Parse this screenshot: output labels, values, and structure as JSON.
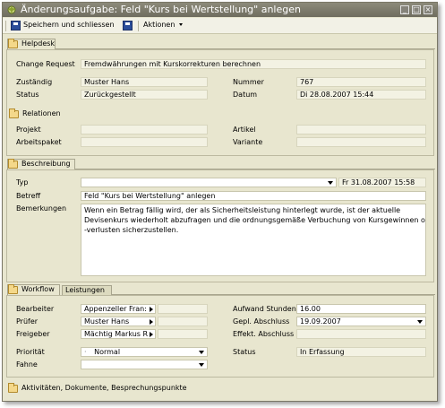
{
  "window": {
    "title": "Änderungsaufgabe: Feld \"Kurs bei Wertstellung\" anlegen"
  },
  "toolbar": {
    "save_close_label": "Speichern und schliessen",
    "actions_label": "Aktionen"
  },
  "helpdesk": {
    "header": "Helpdesk",
    "change_request_label": "Change Request",
    "change_request_value": "Fremdwährungen mit Kurskorrekturen berechnen",
    "zustaendig_label": "Zuständig",
    "zustaendig_value": "Muster Hans",
    "nummer_label": "Nummer",
    "nummer_value": "767",
    "status_label": "Status",
    "status_value": "Zurückgestellt",
    "datum_label": "Datum",
    "datum_value": "Di 28.08.2007 15:44"
  },
  "relationen": {
    "header": "Relationen",
    "projekt_label": "Projekt",
    "projekt_value": "",
    "artikel_label": "Artikel",
    "artikel_value": "",
    "arbeitspaket_label": "Arbeitspaket",
    "arbeitspaket_value": "",
    "variante_label": "Variante",
    "variante_value": ""
  },
  "beschreibung": {
    "header": "Beschreibung",
    "typ_label": "Typ",
    "typ_value": "",
    "typ_date": "Fr 31.08.2007 15:58",
    "betreff_label": "Betreff",
    "betreff_value": "Feld \"Kurs bei Wertstellung\" anlegen",
    "bemerkungen_label": "Bemerkungen",
    "bemerkungen_line1": "Wenn ein Betrag fällig wird, der als Sicherheitsleistung hinterlegt wurde, ist der aktuelle",
    "bemerkungen_line2": "Devisenkurs wiederholt abzufragen und die ordnungsgemäße Verbuchung von Kursgewinnen oder",
    "bemerkungen_line3": "-verlusten sicherzustellen."
  },
  "workflow": {
    "tab_workflow": "Workflow",
    "tab_leistungen": "Leistungen",
    "bearbeiter_label": "Bearbeiter",
    "bearbeiter_value": "Appenzeller Fran:",
    "pruefer_label": "Prüfer",
    "pruefer_value": "Muster Hans",
    "freigeber_label": "Freigeber",
    "freigeber_value": "Mächtig Markus R",
    "aufwand_label": "Aufwand Stunden",
    "aufwand_value": "16.00",
    "gepl_label": "Gepl. Abschluss",
    "gepl_value": "19.09.2007",
    "effekt_label": "Effekt. Abschluss",
    "effekt_value": "",
    "prioritaet_label": "Priorität",
    "prioritaet_value": "Normal",
    "fahne_label": "Fahne",
    "fahne_value": "",
    "status_label": "Status",
    "status_value": "In Erfassung"
  },
  "footer": {
    "label": "Aktivitäten, Dokumente, Besprechungspunkte"
  },
  "colors": {
    "window_bg": "#e8e6cf",
    "titlebar": "#7d7b6c",
    "field_bg": "#f3f2e3"
  }
}
